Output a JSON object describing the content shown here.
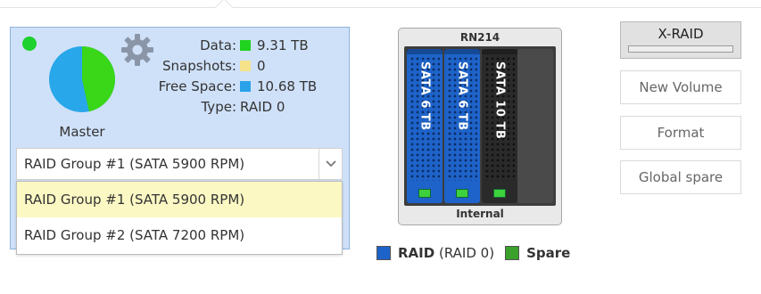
{
  "volume": {
    "name": "Master",
    "status_color": "#1ed12c",
    "stats": [
      {
        "label": "Data:",
        "value": "9.31 TB",
        "color": "#1fd31f"
      },
      {
        "label": "Snapshots:",
        "value": "0",
        "color": "#f5e38a"
      },
      {
        "label": "Free Space:",
        "value": "10.68 TB",
        "color": "#2aa2ea"
      },
      {
        "label": "Type:",
        "value": "RAID 0",
        "color": null
      }
    ],
    "pie": {
      "data_fraction": 0.466,
      "free_fraction": 0.534,
      "data_color": "#3ad618",
      "free_color": "#28a7ea"
    }
  },
  "raid_select": {
    "selected": "RAID Group #1 (SATA 5900 RPM)",
    "options": [
      "RAID Group #1 (SATA 5900 RPM)",
      "RAID Group #2 (SATA 7200 RPM)"
    ]
  },
  "chassis": {
    "model": "RN214",
    "footer": "Internal",
    "bays": [
      {
        "label": "SATA 6 TB",
        "color": "blue"
      },
      {
        "label": "SATA 6 TB",
        "color": "blue"
      },
      {
        "label": "SATA 10 TB",
        "color": "dark"
      },
      {
        "label": "",
        "color": "empty"
      }
    ]
  },
  "legend": {
    "raid_label": "RAID",
    "raid_detail": "(RAID 0)",
    "raid_color": "#1e63c9",
    "spare_label": "Spare",
    "spare_color": "#3aa12a"
  },
  "actions": {
    "xraid": "X-RAID",
    "new_volume": "New Volume",
    "format": "Format",
    "global_spare": "Global spare"
  }
}
